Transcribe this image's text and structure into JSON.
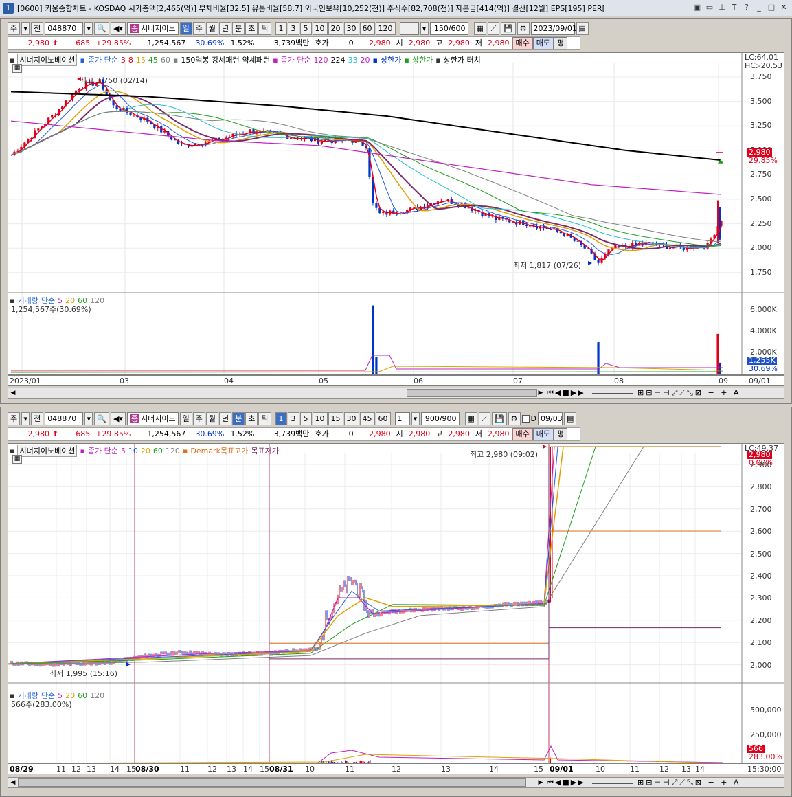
{
  "window": {
    "number": "1",
    "title": "[0600] 키움종합차트 - KOSDAQ 시가총액[2,465(억)] 부채비율[32.5] 유통비율[58.7] 외국인보유[10,252(천)] 주식수[82,708(천)] 자본금[414(억)] 결산[12월] EPS[195] PER[",
    "icons": [
      "window-tile-icon",
      "window-restore-icon",
      "pin-icon",
      "font-icon",
      "help-icon",
      "minimize-icon",
      "maximize-icon",
      "close-icon"
    ]
  },
  "top": {
    "toolbar": {
      "mode": "주",
      "prev": "전",
      "code": "048870",
      "name_tag": "종",
      "name": "시너지이노",
      "periods": [
        "일",
        "주",
        "월",
        "년",
        "분",
        "초",
        "틱"
      ],
      "period_selected": "일",
      "intervals": [
        "1",
        "3",
        "5",
        "10",
        "20",
        "30",
        "60",
        "120"
      ],
      "count": "150/600",
      "date": "2023/09/01"
    },
    "quote": {
      "price": "2,980",
      "arrow": "⬆",
      "change": "685",
      "change_pct": "+29.85%",
      "volume": "1,254,567",
      "vol_ratio": "30.69%",
      "turnover": "1.52%",
      "amount": "3,739백만",
      "hoga_label": "호가",
      "hoga": "0",
      "hoga_price": "2,980",
      "open_label": "시",
      "open": "2,980",
      "high_label": "고",
      "high": "2,980",
      "low_label": "저",
      "low": "2,980",
      "buy": "매수",
      "sell": "매도",
      "eval": "평"
    },
    "legend": {
      "name": "시너지이노베이션",
      "ma_label": "종가 단순",
      "ma": [
        "3",
        "8",
        "15",
        "45",
        "60"
      ],
      "pattern1": "150억봉 강세패턴",
      "pattern2": "약세패턴",
      "ma2_label": "종가 단순",
      "ma2": [
        "120",
        "224",
        "33",
        "20"
      ],
      "limit1": "상한가",
      "limit2": "상한가",
      "limit3": "상한가 터치"
    },
    "price_axis": [
      "3,750",
      "3,500",
      "3,250",
      "3,000",
      "2,750",
      "2,500",
      "2,250",
      "2,000",
      "1,750"
    ],
    "lc": "LC:64.01",
    "hc": "HC:-20.53",
    "last_price": "2,980",
    "last_pct": "29.85%",
    "high_note": "최고 3,750 (02/14)",
    "low_note": "최저 1,817 (07/26)",
    "volume_legend": {
      "label": "거래량",
      "ma_label": "단순",
      "ma": [
        "5",
        "20",
        "60",
        "120"
      ],
      "value": "1,254,567주(30.69%)"
    },
    "volume_axis": [
      "6,000K",
      "4,000K",
      "2,000K"
    ],
    "vol_tag": "1,255K",
    "vol_pct": "30.69%",
    "dates": [
      "2023/01",
      "03",
      "04",
      "05",
      "06",
      "07",
      "08",
      "09",
      "09/01"
    ]
  },
  "bottom": {
    "toolbar": {
      "mode": "주",
      "prev": "전",
      "code": "048870",
      "name_tag": "종",
      "name": "시너지이노",
      "periods": [
        "일",
        "주",
        "월",
        "년",
        "분",
        "초",
        "틱"
      ],
      "period_selected": "분",
      "intervals": [
        "1",
        "3",
        "5",
        "10",
        "15",
        "30",
        "45",
        "60"
      ],
      "interval_selected": "1",
      "spin": "1",
      "count": "900/900",
      "checkbox": "D",
      "date": "09/03"
    },
    "quote": {
      "price": "2,980",
      "arrow": "⬆",
      "change": "685",
      "change_pct": "+29.85%",
      "volume": "1,254,567",
      "vol_ratio": "30.69%",
      "turnover": "1.52%",
      "amount": "3,739백만",
      "hoga_label": "호가",
      "hoga": "0",
      "hoga_price": "2,980",
      "open_label": "시",
      "open": "2,980",
      "high_label": "고",
      "high": "2,980",
      "low_label": "저",
      "low": "2,980",
      "buy": "매수",
      "sell": "매도",
      "eval": "평"
    },
    "legend": {
      "name": "시너지이노베이션",
      "ma_label": "종가 단순",
      "ma": [
        "5",
        "10",
        "20",
        "60",
        "120"
      ],
      "demark1": "Demark목표고가",
      "demark2": "목표저가"
    },
    "price_axis": [
      "2,900",
      "2,800",
      "2,700",
      "2,600",
      "2,500",
      "2,400",
      "2,300",
      "2,200",
      "2,100",
      "2,000"
    ],
    "lc": "LC:49.37",
    "last_price": "2,980",
    "last_pct": "0.00%",
    "high_note": "최고 2,980 (09:02)",
    "low_note": "최저 1,995 (15:16)",
    "volume_legend": {
      "label": "거래량",
      "ma_label": "단순",
      "ma": [
        "5",
        "20",
        "60",
        "120"
      ],
      "value": "566주(283.00%)"
    },
    "volume_axis": [
      "500,000",
      "250,000"
    ],
    "vol_tag": "566",
    "vol_pct": "283.00%",
    "dates": [
      "08/29",
      "11",
      "12",
      "13",
      "14",
      "15",
      "08/30",
      "11",
      "12",
      "13",
      "14",
      "15",
      "08/31",
      "10",
      "11",
      "12",
      "13",
      "14",
      "15",
      "09/01",
      "10",
      "11",
      "12",
      "13",
      "14"
    ],
    "time_label": "15:30:00"
  },
  "colors": {
    "up": "#e0001b",
    "down": "#0033cc",
    "ma3": "#e0001b",
    "ma8": "#2060e0",
    "ma15": "#e0a000",
    "ma45": "#1ca01c",
    "ma60": "#7a2a6a",
    "ma120": "#808080",
    "ma224": "#000000",
    "ma33": "#20c0d0",
    "ma20": "#c020c0"
  }
}
